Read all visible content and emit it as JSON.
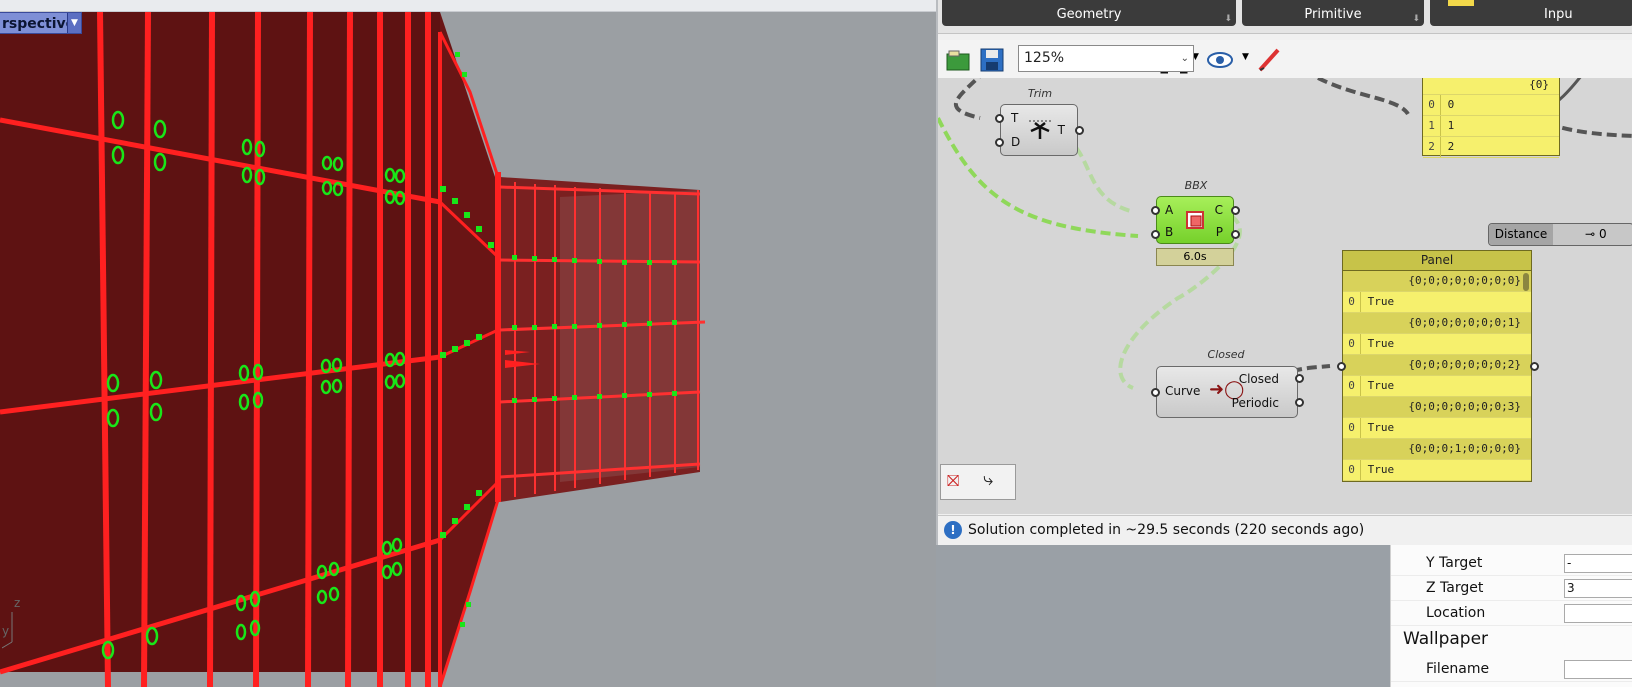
{
  "viewport": {
    "label": "rspective",
    "axis_z": "z",
    "axis_y": "y"
  },
  "ribbon": {
    "groups": [
      {
        "label": "Geometry"
      },
      {
        "label": "Primitive"
      },
      {
        "label": "Inpu"
      }
    ]
  },
  "toolbar": {
    "zoom_value": "125%"
  },
  "canvas": {
    "trim": {
      "title": "Trim",
      "in": [
        "T",
        "D"
      ],
      "out": [
        "T"
      ]
    },
    "bbx": {
      "title": "BBX",
      "in": [
        "A",
        "B"
      ],
      "out": [
        "C",
        "P"
      ],
      "time": "6.0s"
    },
    "closed": {
      "title": "Closed",
      "in": [
        "Curve"
      ],
      "out": [
        "Closed",
        "Periodic"
      ]
    },
    "distance": {
      "label": "Distance",
      "value": "0"
    },
    "top_panel": {
      "path": "{0}",
      "rows": [
        {
          "i": "0",
          "v": "0"
        },
        {
          "i": "1",
          "v": "1"
        },
        {
          "i": "2",
          "v": "2"
        }
      ]
    },
    "panel": {
      "title": "Panel",
      "items": [
        {
          "path": "{0;0;0;0;0;0;0;0}",
          "i": "0",
          "v": "True"
        },
        {
          "path": "{0;0;0;0;0;0;0;1}",
          "i": "0",
          "v": "True"
        },
        {
          "path": "{0;0;0;0;0;0;0;2}",
          "i": "0",
          "v": "True"
        },
        {
          "path": "{0;0;0;0;0;0;0;3}",
          "i": "0",
          "v": "True"
        },
        {
          "path": "{0;0;0;1;0;0;0;0}",
          "i": "0",
          "v": "True"
        }
      ]
    }
  },
  "status": {
    "message": "Solution completed in ~29.5 seconds (220 seconds ago)"
  },
  "properties": {
    "y_target": "Y Target",
    "z_target": "Z Target",
    "location": "Location",
    "wallpaper": "Wallpaper",
    "filename": "Filename",
    "y_value": "-",
    "z_value": "3"
  },
  "colors": {
    "viewport_bg": "#9b9fa3",
    "geometry_red": "#ff1a1a",
    "panel_fill": "#5a1010",
    "point_green": "#19e619",
    "bbx_green": "#8ee83a",
    "panel_yellow": "#f6f06d"
  }
}
